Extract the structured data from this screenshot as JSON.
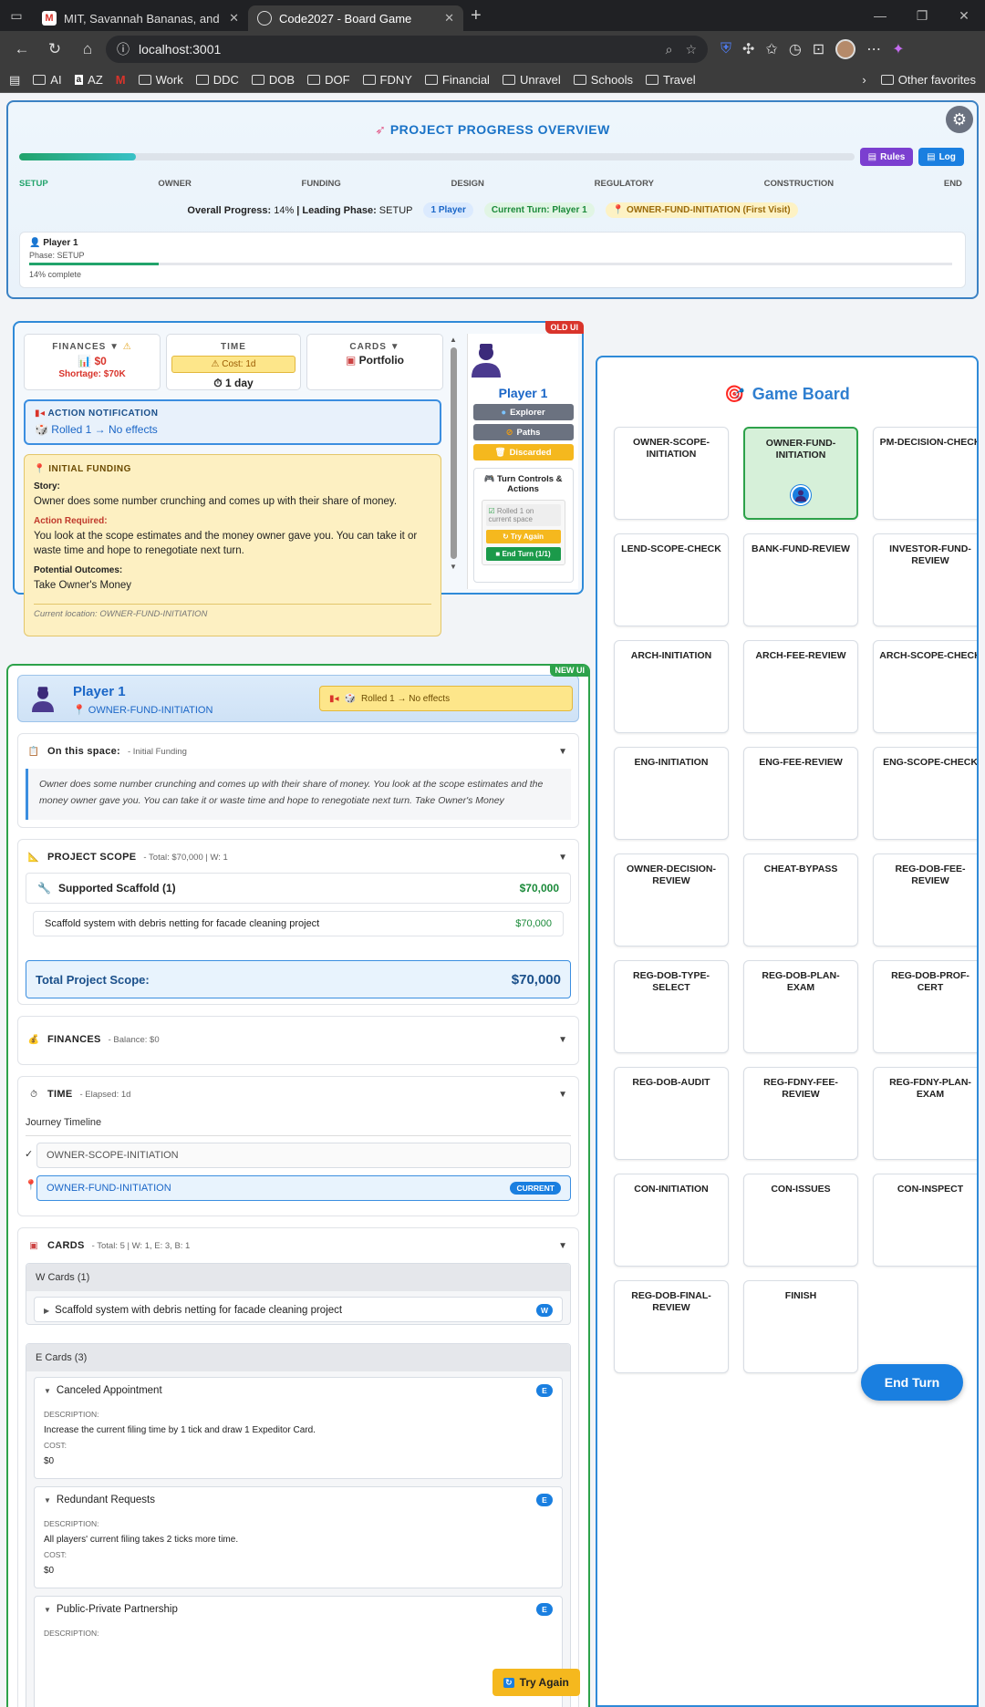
{
  "browser": {
    "tabs": [
      {
        "title": "MIT, Savannah Bananas, and Billio",
        "active": false
      },
      {
        "title": "Code2027 - Board Game",
        "active": true
      }
    ],
    "url": "localhost:3001",
    "bookmarks": [
      "AI",
      "AZ",
      "Work",
      "DDC",
      "DOB",
      "DOF",
      "FDNY",
      "Financial",
      "Unravel",
      "Schools",
      "Travel"
    ],
    "other_favorites": "Other favorites"
  },
  "progress": {
    "title": "PROJECT PROGRESS OVERVIEW",
    "percent": 14,
    "rules_label": "Rules",
    "log_label": "Log",
    "phases": [
      "SETUP",
      "OWNER",
      "FUNDING",
      "DESIGN",
      "REGULATORY",
      "CONSTRUCTION",
      "END"
    ],
    "overall_label": "Overall Progress:",
    "overall_value": "14%",
    "leading_label": "| Leading Phase:",
    "leading_value": "SETUP",
    "players_pill": "1 Player",
    "turn_pill": "Current Turn: Player 1",
    "location_pill": "OWNER-FUND-INITIATION (First Visit)",
    "player_card": {
      "name": "Player 1",
      "phase": "Phase: SETUP",
      "complete": "14% complete",
      "percent": 14
    }
  },
  "old_ui": {
    "badge": "OLD UI",
    "finances_label": "FINANCES ▼",
    "finances_value": "$0",
    "shortage": "Shortage: $70K",
    "time_label": "TIME",
    "time_cost": "Cost: 1d",
    "time_value": "1 day",
    "cards_label": "CARDS ▼",
    "cards_value": "Portfolio",
    "notif_title": "ACTION NOTIFICATION",
    "notif_body": "Rolled 1 → No effects",
    "funding_title": "INITIAL FUNDING",
    "story_label": "Story:",
    "story": "Owner does some number crunching and comes up with their share of money.",
    "action_label": "Action Required:",
    "action": "You look at the scope estimates and the money owner gave you. You can take it or waste time and hope to renegotiate next turn.",
    "outcomes_label": "Potential Outcomes:",
    "outcomes": "Take Owner's Money",
    "current_location": "Current location: OWNER-FUND-INITIATION",
    "player_name": "Player 1",
    "explorer_label": "Explorer",
    "paths_label": "Paths",
    "discarded_label": "Discarded",
    "turn_controls": "Turn Controls & Actions",
    "rolled_on": "Rolled 1 on current space",
    "try_again": "Try Again",
    "end_turn": "End Turn (1/1)"
  },
  "new_ui": {
    "badge": "NEW UI",
    "player_name": "Player 1",
    "location": "OWNER-FUND-INITIATION",
    "roll_note": "Rolled 1 → No effects",
    "space": {
      "title": "On this space:",
      "sub": "- Initial Funding",
      "text": "Owner does some number crunching and comes up with their share of money. You look at the scope estimates and the money owner gave you. You can take it or waste time and hope to renegotiate next turn. Take Owner's Money"
    },
    "scope": {
      "title": "PROJECT SCOPE",
      "sub": "- Total: $70,000 | W: 1",
      "item_name": "Supported Scaffold (1)",
      "item_amount": "$70,000",
      "detail_name": "Scaffold system with debris netting for facade cleaning project",
      "detail_amount": "$70,000",
      "total_label": "Total Project Scope:",
      "total_amount": "$70,000"
    },
    "finances": {
      "title": "FINANCES",
      "sub": "- Balance: $0"
    },
    "time": {
      "title": "TIME",
      "sub": "- Elapsed: 1d",
      "journey": "Journey Timeline",
      "entries": [
        {
          "name": "OWNER-SCOPE-INITIATION",
          "current": false
        },
        {
          "name": "OWNER-FUND-INITIATION",
          "current": true
        }
      ],
      "current_badge": "CURRENT"
    },
    "cards": {
      "title": "CARDS",
      "sub": "- Total: 5 | W: 1, E: 3, B: 1",
      "w_group": "W Cards (1)",
      "w_card": "Scaffold system with debris netting for facade cleaning project",
      "w_tag": "W",
      "e_group": "E Cards (3)",
      "e_cards": [
        {
          "name": "Canceled Appointment",
          "desc": "Increase the current filing time by 1 tick and draw 1 Expeditor Card.",
          "cost": "$0"
        },
        {
          "name": "Redundant Requests",
          "desc": "All players' current filing takes 2 ticks more time.",
          "cost": "$0"
        },
        {
          "name": "Public-Private Partnership",
          "desc": "",
          "cost": ""
        }
      ],
      "e_tag": "E",
      "desc_label": "DESCRIPTION:",
      "cost_label": "COST:"
    },
    "try_again": "Try Again"
  },
  "board": {
    "title": "Game Board",
    "spaces": [
      "OWNER-SCOPE-INITIATION",
      "OWNER-FUND-INITIATION",
      "PM-DECISION-CHECK",
      "LEND-SCOPE-CHECK",
      "BANK-FUND-REVIEW",
      "INVESTOR-FUND-REVIEW",
      "ARCH-INITIATION",
      "ARCH-FEE-REVIEW",
      "ARCH-SCOPE-CHECK",
      "ENG-INITIATION",
      "ENG-FEE-REVIEW",
      "ENG-SCOPE-CHECK",
      "OWNER-DECISION-REVIEW",
      "CHEAT-BYPASS",
      "REG-DOB-FEE-REVIEW",
      "REG-DOB-TYPE-SELECT",
      "REG-DOB-PLAN-EXAM",
      "REG-DOB-PROF-CERT",
      "REG-DOB-AUDIT",
      "REG-FDNY-FEE-REVIEW",
      "REG-FDNY-PLAN-EXAM",
      "CON-INITIATION",
      "CON-ISSUES",
      "CON-INSPECT",
      "REG-DOB-FINAL-REVIEW",
      "FINISH"
    ],
    "current_space": "OWNER-FUND-INITIATION",
    "end_turn": "End Turn"
  },
  "colors": {
    "accent": "#1a7fe0",
    "old_ui": "#d9342b",
    "new_ui": "#2da24a",
    "current_space": "#2da24a"
  }
}
